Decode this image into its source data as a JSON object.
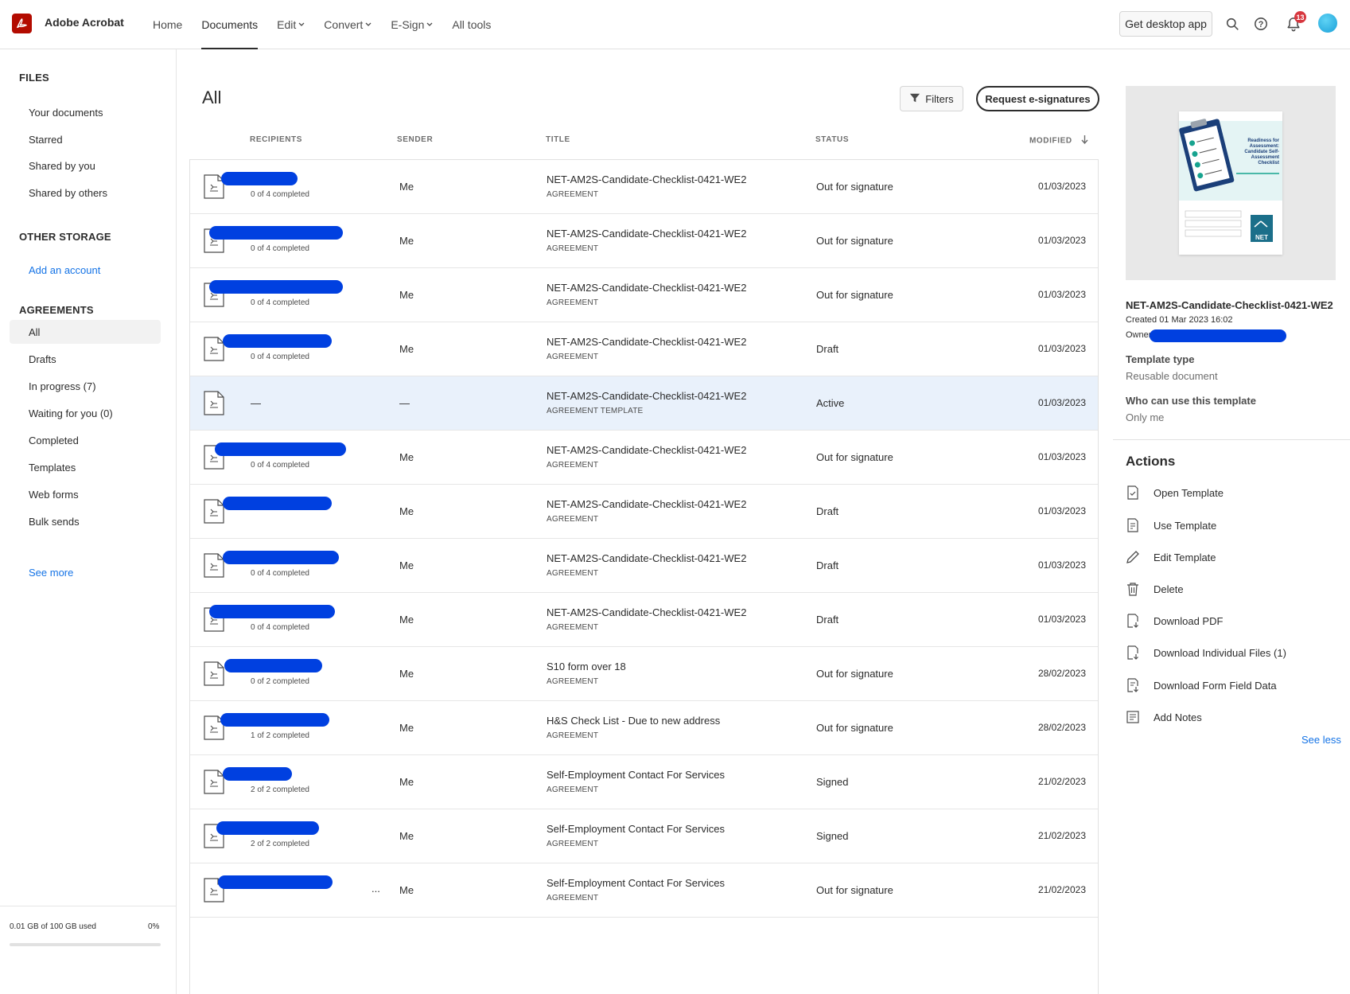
{
  "app": {
    "name": "Adobe Acrobat"
  },
  "nav": [
    {
      "label": "Home",
      "caret": false
    },
    {
      "label": "Documents",
      "caret": false,
      "active": true
    },
    {
      "label": "Edit",
      "caret": true
    },
    {
      "label": "Convert",
      "caret": true
    },
    {
      "label": "E-Sign",
      "caret": true
    },
    {
      "label": "All tools",
      "caret": false
    }
  ],
  "header": {
    "desktop_label": "Get desktop app",
    "notifications": "13"
  },
  "sidebar": {
    "files_head": "FILES",
    "files": [
      "Your documents",
      "Starred",
      "Shared by you",
      "Shared by others"
    ],
    "other_head": "OTHER STORAGE",
    "add_account": "Add an account",
    "agreements_head": "AGREEMENTS",
    "agreements": [
      "All",
      "Drafts",
      "In progress (7)",
      "Waiting for you (0)",
      "Completed",
      "Templates",
      "Web forms",
      "Bulk sends"
    ],
    "see_more": "See more",
    "storage_text": "0.01 GB of 100 GB used",
    "storage_pct": "0%",
    "storage_fraction": 0
  },
  "main": {
    "title": "All",
    "filters_label": "Filters",
    "request_label": "Request e-signatures",
    "columns": {
      "recipients": "RECIPIENTS",
      "sender": "SENDER",
      "title": "TITLE",
      "status": "STATUS",
      "modified": "MODIFIED"
    }
  },
  "rows": [
    {
      "completed": "0 of 4 completed",
      "sender": "Me",
      "title": "NET-AM2S-Candidate-Checklist-0421-WE2",
      "type": "AGREEMENT",
      "status": "Out for signature",
      "modified": "01/03/2023"
    },
    {
      "completed": "0 of 4 completed",
      "sender": "Me",
      "title": "NET-AM2S-Candidate-Checklist-0421-WE2",
      "type": "AGREEMENT",
      "status": "Out for signature",
      "modified": "01/03/2023"
    },
    {
      "completed": "0 of 4 completed",
      "sender": "Me",
      "title": "NET-AM2S-Candidate-Checklist-0421-WE2",
      "type": "AGREEMENT",
      "status": "Out for signature",
      "modified": "01/03/2023"
    },
    {
      "completed": "0 of 4 completed",
      "sender": "Me",
      "title": "NET-AM2S-Candidate-Checklist-0421-WE2",
      "type": "AGREEMENT",
      "status": "Draft",
      "modified": "01/03/2023"
    },
    {
      "completed": "",
      "sender": "—",
      "title": "NET-AM2S-Candidate-Checklist-0421-WE2",
      "type": "AGREEMENT TEMPLATE",
      "status": "Active",
      "modified": "01/03/2023",
      "recipient_dash": "—"
    },
    {
      "completed": "0 of 4 completed",
      "sender": "Me",
      "title": "NET-AM2S-Candidate-Checklist-0421-WE2",
      "type": "AGREEMENT",
      "status": "Out for signature",
      "modified": "01/03/2023"
    },
    {
      "completed": "",
      "sender": "Me",
      "title": "NET-AM2S-Candidate-Checklist-0421-WE2",
      "type": "AGREEMENT",
      "status": "Draft",
      "modified": "01/03/2023"
    },
    {
      "completed": "0 of 4 completed",
      "sender": "Me",
      "title": "NET-AM2S-Candidate-Checklist-0421-WE2",
      "type": "AGREEMENT",
      "status": "Draft",
      "modified": "01/03/2023"
    },
    {
      "completed": "0 of 4 completed",
      "sender": "Me",
      "title": "NET-AM2S-Candidate-Checklist-0421-WE2",
      "type": "AGREEMENT",
      "status": "Draft",
      "modified": "01/03/2023"
    },
    {
      "completed": "0 of 2 completed",
      "sender": "Me",
      "title": "S10 form over 18",
      "type": "AGREEMENT",
      "status": "Out for signature",
      "modified": "28/02/2023"
    },
    {
      "completed": "1 of 2 completed",
      "sender": "Me",
      "title": "H&S Check List - Due to new address",
      "type": "AGREEMENT",
      "status": "Out for signature",
      "modified": "28/02/2023"
    },
    {
      "completed": "2 of 2 completed",
      "sender": "Me",
      "title": "Self-Employment Contact For Services",
      "type": "AGREEMENT",
      "status": "Signed",
      "modified": "21/02/2023"
    },
    {
      "completed": "2 of 2 completed",
      "sender": "Me",
      "title": "Self-Employment Contact For Services",
      "type": "AGREEMENT",
      "status": "Signed",
      "modified": "21/02/2023"
    },
    {
      "completed": "",
      "sender": "Me",
      "title": "Self-Employment Contact For Services",
      "type": "AGREEMENT",
      "status": "Out for signature",
      "modified": "21/02/2023",
      "ellipsis": "..."
    }
  ],
  "panel": {
    "thumb_heading": "Readiness for Assessment: Candidate Self-Assessment Checklist",
    "thumb_logo": "NET",
    "title": "NET-AM2S-Candidate-Checklist-0421-WE2",
    "created": "Created 01 Mar 2023 16:02",
    "owner_label": "Owner",
    "template_type_label": "Template type",
    "template_type_value": "Reusable document",
    "who_label": "Who can use this template",
    "who_value": "Only me",
    "actions_head": "Actions",
    "actions": [
      {
        "label": "Open Template",
        "icon": "open-template-icon"
      },
      {
        "label": "Use Template",
        "icon": "use-template-icon"
      },
      {
        "label": "Edit Template",
        "icon": "pencil-icon"
      },
      {
        "label": "Delete",
        "icon": "trash-icon"
      },
      {
        "label": "Download PDF",
        "icon": "download-pdf-icon"
      },
      {
        "label": "Download Individual Files (1)",
        "icon": "download-files-icon"
      },
      {
        "label": "Download Form Field Data",
        "icon": "download-data-icon"
      },
      {
        "label": "Add Notes",
        "icon": "notes-icon"
      }
    ],
    "see_less": "See less"
  },
  "colors": {
    "accent": "#1473e6",
    "brand": "#b30b00",
    "redaction": "#0040e0",
    "highlight": "#e9f1fb"
  }
}
